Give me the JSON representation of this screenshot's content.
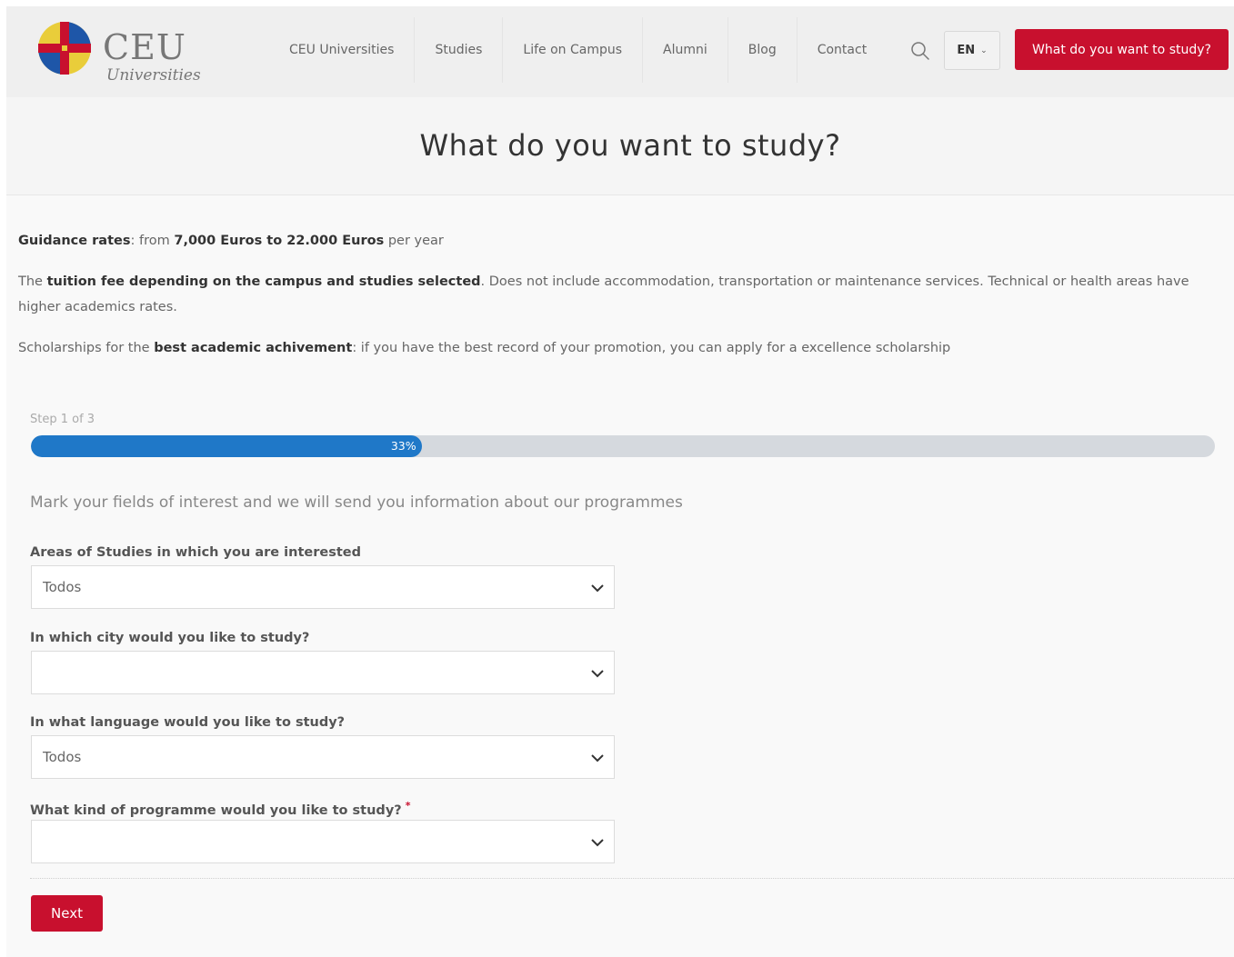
{
  "brand": {
    "name": "CEU",
    "subtitle": "Universities",
    "colors": {
      "primary": "#c8102e",
      "progress": "#1f78c8",
      "logo_yellow": "#e9cd3a",
      "logo_blue": "#1e56a8"
    }
  },
  "nav": {
    "items": [
      "CEU Universities",
      "Studies",
      "Life on Campus",
      "Alumni",
      "Blog",
      "Contact"
    ],
    "search_icon": "search-icon",
    "language": "EN",
    "cta_label": "What do you want to study?"
  },
  "page": {
    "title": "What do you want to study?"
  },
  "info": {
    "rates_label": "Guidance rates",
    "rates_mid": ": from ",
    "rates_amount": "7,000 Euros to 22.000 Euros",
    "rates_tail": " per year",
    "tuition_pre": "The ",
    "tuition_bold": "tuition fee depending on the campus and studies selected",
    "tuition_tail": ". Does not include accommodation, transportation or maintenance services. Technical or health areas have higher academics rates.",
    "schol_pre": "Scholarships for the ",
    "schol_bold": "best academic achivement",
    "schol_tail": ": if you have the best record of your promotion, you can apply for a excellence scholarship"
  },
  "form": {
    "step_label": "Step 1 of 3",
    "progress_percent": 33,
    "progress_text": "33%",
    "description": "Mark your fields of interest and we will send you information about our programmes",
    "fields": [
      {
        "label": "Areas of Studies in which you are interested",
        "value": "Todos",
        "required": false
      },
      {
        "label": "In which city would you like to study?",
        "value": "",
        "required": false
      },
      {
        "label": "In what language would you like to study?",
        "value": "Todos",
        "required": false
      },
      {
        "label": "What kind of programme would you like to study?",
        "value": "",
        "required": true,
        "required_mark": "*"
      }
    ],
    "next_label": "Next"
  }
}
